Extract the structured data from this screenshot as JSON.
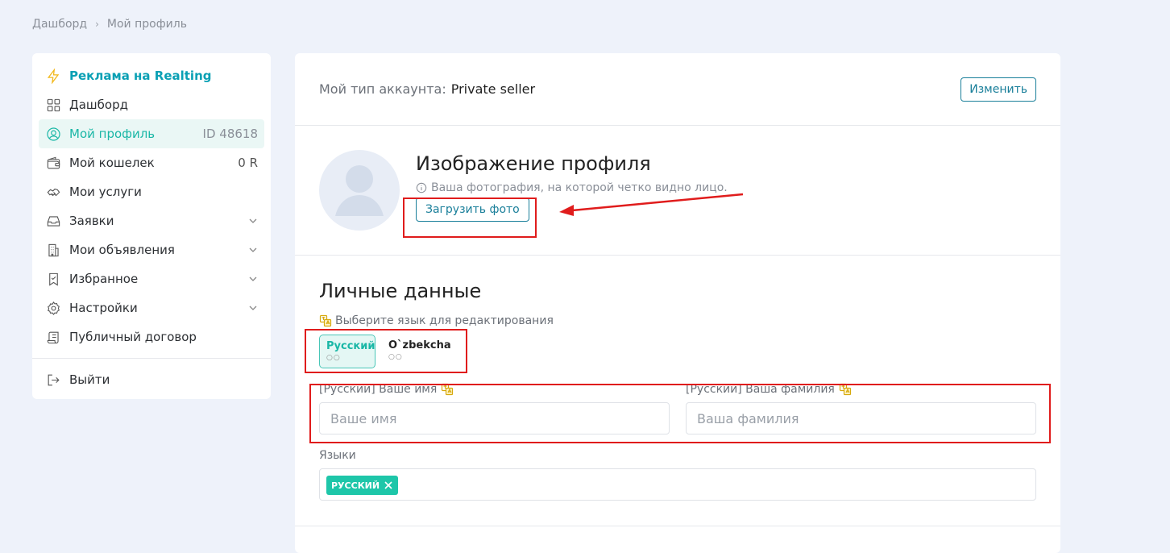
{
  "breadcrumb": {
    "root": "Дашборд",
    "current": "Мой профиль"
  },
  "sidebar": {
    "items": [
      {
        "label": "Реклама на Realting",
        "icon": "lightning-icon"
      },
      {
        "label": "Дашборд",
        "icon": "grid-icon"
      },
      {
        "label": "Мой профиль",
        "icon": "user-circle-icon",
        "right": "ID 48618"
      },
      {
        "label": "Мой кошелек",
        "icon": "wallet-icon",
        "right": "0 R"
      },
      {
        "label": "Мои услуги",
        "icon": "handshake-icon"
      },
      {
        "label": "Заявки",
        "icon": "inbox-icon"
      },
      {
        "label": "Мои объявления",
        "icon": "building-icon"
      },
      {
        "label": "Избранное",
        "icon": "bookmark-icon"
      },
      {
        "label": "Настройки",
        "icon": "gear-icon"
      },
      {
        "label": "Публичный договор",
        "icon": "scroll-icon"
      },
      {
        "label": "Выйти",
        "icon": "logout-icon"
      }
    ]
  },
  "account": {
    "label": "Мой тип аккаунта:",
    "value": "Private seller",
    "change_label": "Изменить"
  },
  "profile_image": {
    "title": "Изображение профиля",
    "hint": "Ваша фотография, на которой четко видно лицо.",
    "upload_label": "Загрузить фото"
  },
  "personal": {
    "title": "Личные данные",
    "lang_hint": "Выберите язык для редактирования",
    "tabs": [
      {
        "name": "Русский",
        "dots": "○○"
      },
      {
        "name": "O`zbekcha",
        "dots": "○○"
      }
    ],
    "first_name_label": "[Русский] Ваше имя",
    "first_name_placeholder": "Ваше имя",
    "last_name_label": "[Русский] Ваша фамилия",
    "last_name_placeholder": "Ваша фамилия",
    "languages_label": "Языки",
    "language_tag": "РУССКИЙ"
  },
  "colors": {
    "accent": "#1ab7a6",
    "primary": "#1a7f9a",
    "highlight": "#e01c1c"
  }
}
